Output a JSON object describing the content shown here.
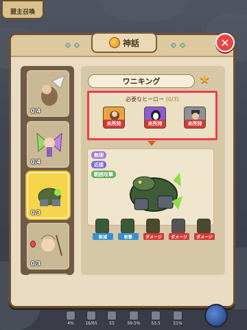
{
  "top_button": {
    "label": "盟主召喚"
  },
  "panel": {
    "title": "神話"
  },
  "close_label": "✕",
  "hero_list": [
    {
      "level": "0/4"
    },
    {
      "level": "0/4"
    },
    {
      "level": "0/3"
    },
    {
      "level": "0/3"
    },
    {
      "level": ""
    }
  ],
  "detail": {
    "name": "ワニキング",
    "required": {
      "label": "必要なヒーロー",
      "count": "(0/3)",
      "heroes": [
        {
          "status": "未所持"
        },
        {
          "status": "未所持"
        },
        {
          "status": "未所持"
        }
      ]
    },
    "tags": [
      "無理",
      "近接",
      "範囲攻撃"
    ],
    "skills": [
      {
        "label": "斬減"
      },
      {
        "label": "斬撃"
      },
      {
        "label": "ダメージ"
      },
      {
        "label": "ダメージ"
      },
      {
        "label": "ダメージ"
      }
    ]
  },
  "bottom_stats": [
    {
      "value": "4%"
    },
    {
      "value": "16/65"
    },
    {
      "value": "55"
    },
    {
      "value": "59.5%"
    },
    {
      "value": "53.5"
    },
    {
      "value": "51%"
    }
  ],
  "colors": {
    "accent": "#ee3c4d",
    "selected": "#f5d54b",
    "frame": "#6f4e32"
  }
}
